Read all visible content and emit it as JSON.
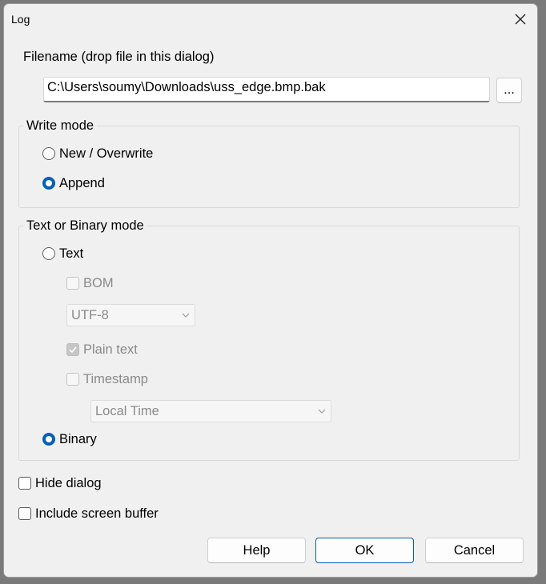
{
  "window": {
    "title": "Log"
  },
  "filename": {
    "label": "Filename (drop file in this dialog)",
    "value": "C:\\Users\\soumy\\Downloads\\uss_edge.bmp.bak",
    "browse_label": "..."
  },
  "write_mode": {
    "legend": "Write mode",
    "options": [
      {
        "label": "New / Overwrite",
        "selected": false
      },
      {
        "label": "Append",
        "selected": true
      }
    ]
  },
  "text_binary": {
    "legend": "Text or Binary mode",
    "text_label": "Text",
    "text_selected": false,
    "bom_label": "BOM",
    "bom_checked": false,
    "encoding_value": "UTF-8",
    "plain_text_label": "Plain text",
    "plain_text_checked": true,
    "timestamp_label": "Timestamp",
    "timestamp_checked": false,
    "time_value": "Local Time",
    "binary_label": "Binary",
    "binary_selected": true
  },
  "hide_dialog": {
    "label": "Hide dialog",
    "checked": false
  },
  "include_screen_buffer": {
    "label": "Include screen buffer",
    "checked": false
  },
  "buttons": {
    "help": "Help",
    "ok": "OK",
    "cancel": "Cancel"
  },
  "colors": {
    "accent": "#005fb8",
    "background": "#f0f0f0",
    "disabled_text": "#8a8a8a"
  },
  "icons": {
    "close": "close-icon",
    "dropdown": "chevron-down-icon",
    "check": "checkmark-icon"
  }
}
